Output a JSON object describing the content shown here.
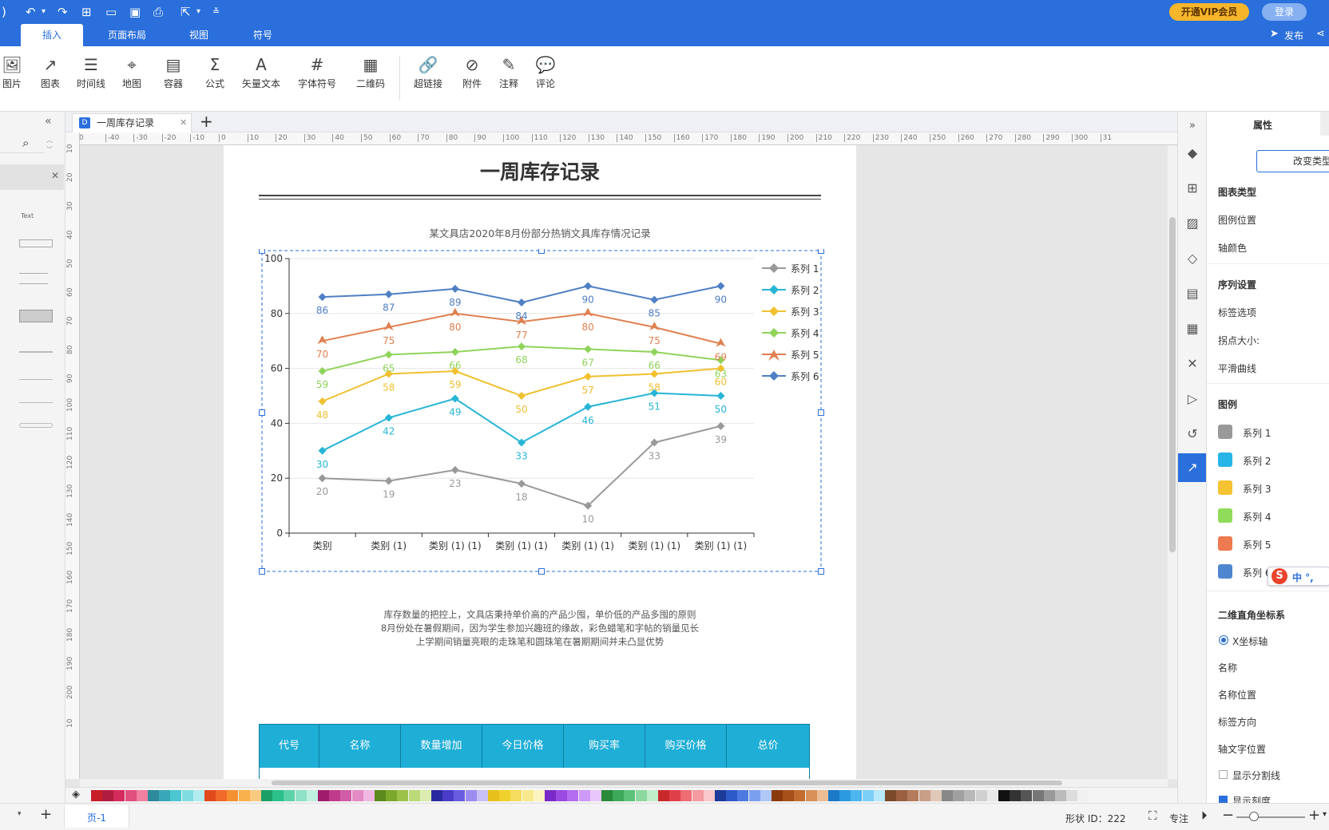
{
  "titlebar": {
    "vip_label": "开通VIP会员",
    "login_label": "登录",
    "publish_label": "发布"
  },
  "tabs": [
    {
      "label": "插入",
      "active": true
    },
    {
      "label": "页面布局"
    },
    {
      "label": "视图"
    },
    {
      "label": "符号"
    }
  ],
  "ribbon": [
    {
      "label": "图片",
      "icon": "image-icon"
    },
    {
      "label": "图表",
      "icon": "chart-icon"
    },
    {
      "label": "时间线",
      "icon": "timeline-icon"
    },
    {
      "label": "地图",
      "icon": "map-pin-icon"
    },
    {
      "label": "容器",
      "icon": "container-icon"
    },
    {
      "label": "公式",
      "icon": "sigma-icon"
    },
    {
      "label": "矢量文本",
      "icon": "vector-text-icon"
    },
    {
      "label": "字体符号",
      "icon": "hash-icon"
    },
    {
      "label": "二维码",
      "icon": "qrcode-icon"
    },
    {
      "label": "超链接",
      "icon": "link-icon"
    },
    {
      "label": "附件",
      "icon": "attachment-icon"
    },
    {
      "label": "注释",
      "icon": "pen-icon"
    },
    {
      "label": "评论",
      "icon": "comment-icon"
    }
  ],
  "document": {
    "tab_title": "一周库存记录",
    "title": "一周库存记录",
    "subtitle": "某文具店2020年8月份部分热销文具库存情况记录",
    "description": [
      "库存数量的把控上，文具店秉持单价高的产品少囤，单价低的产品多囤的原则",
      "8月份处在暑假期间，因为学生参加兴趣班的缘故，彩色蜡笔和字帖的销量见长",
      "上学期间销量亮眼的走珠笔和圆珠笔在暑期期间并未凸显优势"
    ],
    "table_headers": [
      "代号",
      "名称",
      "数量增加",
      "今日价格",
      "购买率",
      "购买价格",
      "总价"
    ]
  },
  "left_panel": {
    "text_label": "Text"
  },
  "ruler": {
    "h_ticks": [
      "0",
      "-40",
      "-30",
      "-20",
      "-10",
      "0",
      "10",
      "20",
      "30",
      "40",
      "50",
      "60",
      "70",
      "80",
      "90",
      "100",
      "110",
      "120",
      "130",
      "140",
      "150",
      "160",
      "170",
      "180",
      "190",
      "200",
      "210",
      "220",
      "230",
      "240",
      "250",
      "260",
      "270",
      "280",
      "290",
      "300",
      "31"
    ],
    "v_ticks": [
      "10",
      "20",
      "30",
      "40",
      "50",
      "60",
      "70",
      "80",
      "90",
      "100",
      "110",
      "120",
      "130",
      "140",
      "150",
      "160",
      "170",
      "180",
      "190",
      "200",
      "10"
    ]
  },
  "chart_data": {
    "type": "line",
    "categories": [
      "类别",
      "类别 (1)",
      "类别 (1) (1)",
      "类别 (1) (1)",
      "类别 (1) (1)",
      "类别 (1) (1)",
      "类别 (1) (1)"
    ],
    "ylim": [
      0,
      100
    ],
    "yticks": [
      0,
      20,
      40,
      60,
      80,
      100
    ],
    "grid": true,
    "legend_position": "top-right",
    "series": [
      {
        "name": "系列 1",
        "color": "#999999",
        "marker": "diamond",
        "values": [
          20,
          19,
          23,
          18,
          10,
          33,
          39
        ]
      },
      {
        "name": "系列 2",
        "color": "#26b5d6",
        "marker": "diamond",
        "values": [
          30,
          42,
          49,
          33,
          46,
          51,
          50
        ]
      },
      {
        "name": "系列 3",
        "color": "#f0c030",
        "marker": "diamond",
        "values": [
          48,
          58,
          59,
          50,
          57,
          58,
          60
        ]
      },
      {
        "name": "系列 4",
        "color": "#8fd45a",
        "marker": "diamond",
        "values": [
          59,
          65,
          66,
          68,
          67,
          66,
          63
        ]
      },
      {
        "name": "系列 5",
        "color": "#e08050",
        "marker": "triangle",
        "values": [
          70,
          75,
          80,
          77,
          80,
          75,
          69
        ]
      },
      {
        "name": "系列 6",
        "color": "#4f7fc4",
        "marker": "diamond",
        "values": [
          86,
          87,
          89,
          84,
          90,
          85,
          90
        ]
      }
    ]
  },
  "props": {
    "tab_title": "属性",
    "change_type_label": "改变类型",
    "chart_type_label": "图表类型",
    "legend_pos_label": "图例位置",
    "axis_color_label": "轴颜色",
    "series_settings_label": "序列设置",
    "label_options_label": "标签选项",
    "point_size_label": "拐点大小:",
    "smooth_label": "平滑曲线",
    "legend_label": "图例",
    "legend_items": [
      {
        "label": "系列 1",
        "color": "#999999"
      },
      {
        "label": "系列 2",
        "color": "#26b5e6"
      },
      {
        "label": "系列 3",
        "color": "#f5c232"
      },
      {
        "label": "系列 4",
        "color": "#90dc5a"
      },
      {
        "label": "系列 5",
        "color": "#ee7a50"
      },
      {
        "label": "系列 6",
        "color": "#4f86d0"
      }
    ],
    "cartesian_label": "二维直角坐标系",
    "x_axis_label": "X坐标轴",
    "name_label": "名称",
    "name_pos_label": "名称位置",
    "label_dir_label": "标签方向",
    "axis_text_pos_label": "轴文字位置",
    "show_split_label": "显示分割线",
    "show_ticks_label": "显示刻度"
  },
  "status": {
    "page_label": "页-1",
    "shape_id": "形状 ID：222",
    "focus_label": "专注"
  },
  "ime": {
    "label": "中 °,"
  }
}
